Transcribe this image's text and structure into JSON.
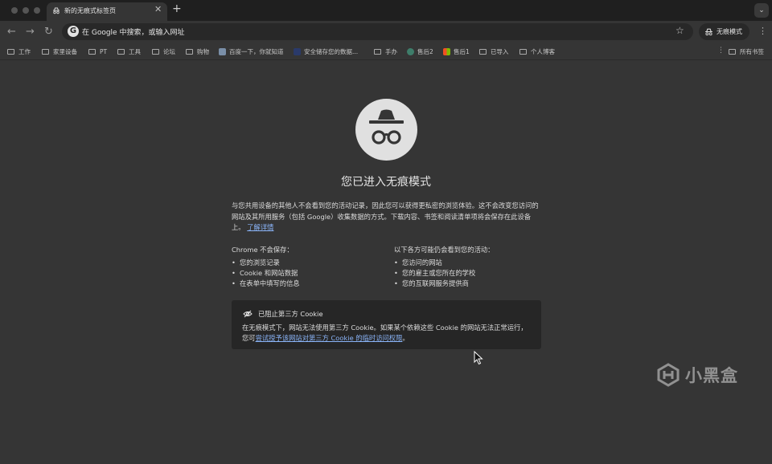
{
  "tab": {
    "title": "新的无痕式标签页",
    "close": "✕",
    "new_tab": "+",
    "tab_search": "⌄"
  },
  "toolbar": {
    "back": "←",
    "forward": "→",
    "reload": "↻",
    "g_icon": "G",
    "omnibox_text": "在 Google 中搜索，或输入网址",
    "star": "☆",
    "incognito_label": "无痕模式",
    "menu": "⋮"
  },
  "bookmarks": {
    "items": [
      {
        "label": "工作",
        "icon": "folder-icon"
      },
      {
        "label": "家里设备",
        "icon": "folder-icon"
      },
      {
        "label": "PT",
        "icon": "folder-icon"
      },
      {
        "label": "工具",
        "icon": "folder-icon"
      },
      {
        "label": "论坛",
        "icon": "folder-icon"
      },
      {
        "label": "购物",
        "icon": "folder-icon"
      },
      {
        "label": "百度一下，你就知道",
        "icon": "baidu-icon"
      },
      {
        "label": "安全储存您的数据...",
        "icon": "site-icon"
      },
      {
        "label": "手办",
        "icon": "folder-icon"
      },
      {
        "label": "售后2",
        "icon": "site-icon"
      },
      {
        "label": "售后1",
        "icon": "microsoft-icon"
      },
      {
        "label": "已导入",
        "icon": "folder-icon"
      },
      {
        "label": "个人博客",
        "icon": "folder-icon"
      }
    ],
    "separator": "⋮",
    "all_bookmarks": "所有书签"
  },
  "main": {
    "heading": "您已进入无痕模式",
    "intro_text": "与您共用设备的其他人不会看到您的活动记录，因此您可以获得更私密的浏览体验。这不会改变您访问的网站及其所用服务（包括 Google）收集数据的方式。下载内容、书签和阅读清单项将会保存在此设备上。",
    "learn_more": "了解详情",
    "left_title": "Chrome 不会保存：",
    "left_items": [
      "您的浏览记录",
      "Cookie 和网站数据",
      "在表单中填写的信息"
    ],
    "right_title": "以下各方可能仍会看到您的活动：",
    "right_items": [
      "您访问的网站",
      "您的雇主或您所在的学校",
      "您的互联网服务提供商"
    ],
    "cookie_title": "已阻止第三方 Cookie",
    "cookie_text": "在无痕模式下，网站无法使用第三方 Cookie。如果某个依赖这些 Cookie 的网站无法正常运行，您可",
    "cookie_link": "尝试授予该网站对第三方 Cookie 的临时访问权限",
    "cookie_end": "。"
  },
  "watermark": "小黑盒"
}
